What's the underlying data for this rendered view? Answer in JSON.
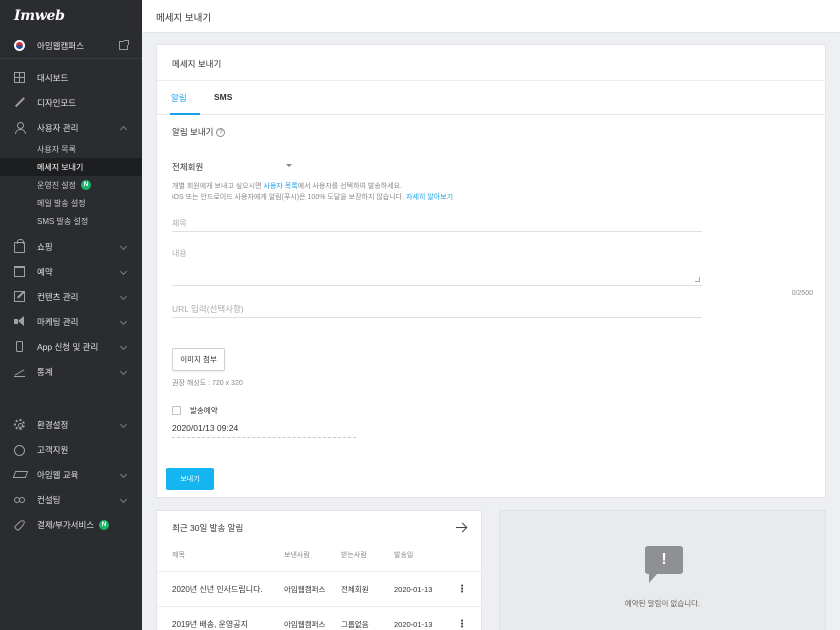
{
  "brand": {
    "logo": "Imweb"
  },
  "site": {
    "name": "아임웹캠퍼스"
  },
  "sidebar": {
    "items": [
      {
        "label": "대시보드",
        "icon": "dashboard-icon"
      },
      {
        "label": "디자인모드",
        "icon": "wand-icon"
      },
      {
        "label": "사용자 관리",
        "icon": "user-icon"
      },
      {
        "label": "쇼핑",
        "icon": "bag-icon"
      },
      {
        "label": "예약",
        "icon": "calendar-icon"
      },
      {
        "label": "컨텐츠 관리",
        "icon": "edit-icon"
      },
      {
        "label": "마케팅 관리",
        "icon": "megaphone-icon"
      },
      {
        "label": "App 신청 및 관리",
        "icon": "phone-icon"
      },
      {
        "label": "통계",
        "icon": "chart-icon"
      }
    ],
    "sub_items": [
      {
        "label": "사용자 목록"
      },
      {
        "label": "메세지 보내기"
      },
      {
        "label": "운영진 설정",
        "badge": "N"
      },
      {
        "label": "메일 발송 설정"
      },
      {
        "label": "SMS 발송 설정"
      }
    ],
    "bottom_items": [
      {
        "label": "환경설정",
        "icon": "gear-icon"
      },
      {
        "label": "고객지원",
        "icon": "chat-icon"
      },
      {
        "label": "아임웹 교육",
        "icon": "graduation-cap-icon"
      },
      {
        "label": "컨설팅",
        "icon": "glasses-icon"
      },
      {
        "label": "결제/부가서비스",
        "icon": "rocket-icon",
        "badge": "N"
      }
    ]
  },
  "page": {
    "title": "메세지 보내기"
  },
  "compose": {
    "card_title": "메세지 보내기",
    "tabs": [
      {
        "label": "알림"
      },
      {
        "label": "SMS"
      }
    ],
    "section_title": "알림 보내기",
    "help_glyph": "?",
    "recipient": "전체회원",
    "hint_line1_pre": "개별 회원에게 보내고 싶으시면 ",
    "hint_line1_link": "사용자 목록",
    "hint_line1_post": "에서 사용자를 선택하여 발송하세요.",
    "hint_line2_pre": "iOS 또는 안드로이드 사용자에게 알림(푸시)은 100% 도달을 보장하지 않습니다. ",
    "hint_line2_link": "자세히 알아보기",
    "title_placeholder": "제목",
    "body_placeholder": "내용",
    "counter": "0/2500",
    "url_placeholder": "URL 입력(선택사항)",
    "attach_label": "이미지 첨부",
    "recommended_size": "권장 해상도 : 720 x 320",
    "schedule_label": "발송예약",
    "schedule_datetime": "2020/01/13 09:24",
    "send_label": "보내기"
  },
  "recent": {
    "title": "최근 30일 발송 알림",
    "columns": [
      "제목",
      "보낸사람",
      "받는사람",
      "발송일"
    ],
    "rows": [
      {
        "title": "2020년 신년 인사드립니다.",
        "sender": "아임웹캠퍼스",
        "receiver": "전체회원",
        "date": "2020-01-13"
      },
      {
        "title": "2019년 배송, 운영공지",
        "sender": "아임웹캠퍼스",
        "receiver": "그룹없음",
        "date": "2020-01-13"
      }
    ],
    "more_glyph": "⋮"
  },
  "scheduled": {
    "empty_glyph": "!",
    "empty_text": "예약된 알림이 없습니다."
  },
  "colors": {
    "accent": "#1aa0e8",
    "sidebar": "#2b2c2f",
    "badge": "#1db56a",
    "send_button": "#14b5f0"
  }
}
